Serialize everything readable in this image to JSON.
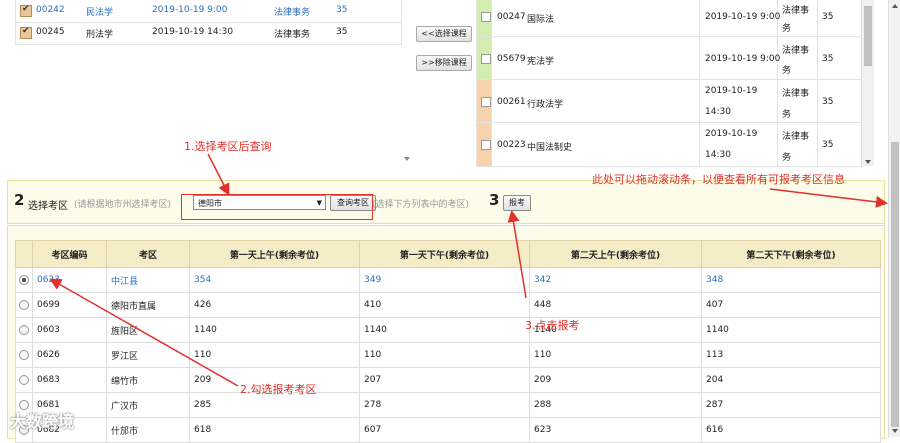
{
  "selected_courses": [
    {
      "code": "00242",
      "name": "民法学",
      "time": "2019-10-19 9:00",
      "major": "法律事务",
      "count": "35"
    },
    {
      "code": "00245",
      "name": "刑法学",
      "time": "2019-10-19 14:30",
      "major": "法律事务",
      "count": "35"
    }
  ],
  "buttons": {
    "select_course": "<<选择课程",
    "remove_course": ">>移除课程",
    "query_area": "查询考区",
    "register": "报考"
  },
  "available_courses": [
    {
      "code": "00247",
      "name": "国际法",
      "time": "2019-10-19 9:00",
      "major_l1": "法律事",
      "major_l2": "务",
      "count": "35"
    },
    {
      "code": "05679",
      "name": "宪法学",
      "time": "2019-10-19 9:00",
      "major_l1": "法律事",
      "major_l2": "务",
      "count": "35"
    },
    {
      "code": "00261",
      "name": "行政法学",
      "time_l1": "2019-10-19",
      "time_l2": "14:30",
      "major_l1": "法律事",
      "major_l2": "务",
      "count": "35"
    },
    {
      "code": "00223",
      "name": "中国法制史",
      "time_l1": "2019-10-19",
      "time_l2": "14:30",
      "major_l1": "法律事",
      "major_l2": "务",
      "count": "35"
    }
  ],
  "step2": {
    "number": "2",
    "label": "选择考区",
    "hint": "(请根据地市州选择考区)",
    "selected_city": "德阳市",
    "hint2": "(选择下方列表中的考区)"
  },
  "step3": {
    "number": "3"
  },
  "table": {
    "headers": [
      "考区编码",
      "考区",
      "第一天上午(剩余考位)",
      "第一天下午(剩余考位)",
      "第二天上午(剩余考位)",
      "第二天下午(剩余考位)"
    ],
    "rows": [
      {
        "code": "0623",
        "area": "中江县",
        "d1am": "354",
        "d1pm": "349",
        "d2am": "342",
        "d2pm": "348",
        "selected": true
      },
      {
        "code": "0699",
        "area": "德阳市直属",
        "d1am": "426",
        "d1pm": "410",
        "d2am": "448",
        "d2pm": "407"
      },
      {
        "code": "0603",
        "area": "旌阳区",
        "d1am": "1140",
        "d1pm": "1140",
        "d2am": "1140",
        "d2pm": "1140"
      },
      {
        "code": "0626",
        "area": "罗江区",
        "d1am": "110",
        "d1pm": "110",
        "d2am": "110",
        "d2pm": "113"
      },
      {
        "code": "0683",
        "area": "绵竹市",
        "d1am": "209",
        "d1pm": "207",
        "d2am": "209",
        "d2pm": "204"
      },
      {
        "code": "0681",
        "area": "广汉市",
        "d1am": "285",
        "d1pm": "278",
        "d2am": "288",
        "d2pm": "287"
      },
      {
        "code": "0682",
        "area": "什邡市",
        "d1am": "618",
        "d1pm": "607",
        "d2am": "623",
        "d2pm": "616"
      }
    ]
  },
  "annotations": {
    "a1": "1.选择考区后查询",
    "a2": "2.勾选报考考区",
    "a3": "3.点击报考",
    "a4": "此处可以拖动滚动条，以便查看所有可报考考区信息"
  },
  "watermark": "大数跨境",
  "colors": {
    "link": "#2a6fbf",
    "annotation": "#e2302a",
    "header_bg": "#f4ecc7",
    "panel_bg": "#fdfbea"
  }
}
